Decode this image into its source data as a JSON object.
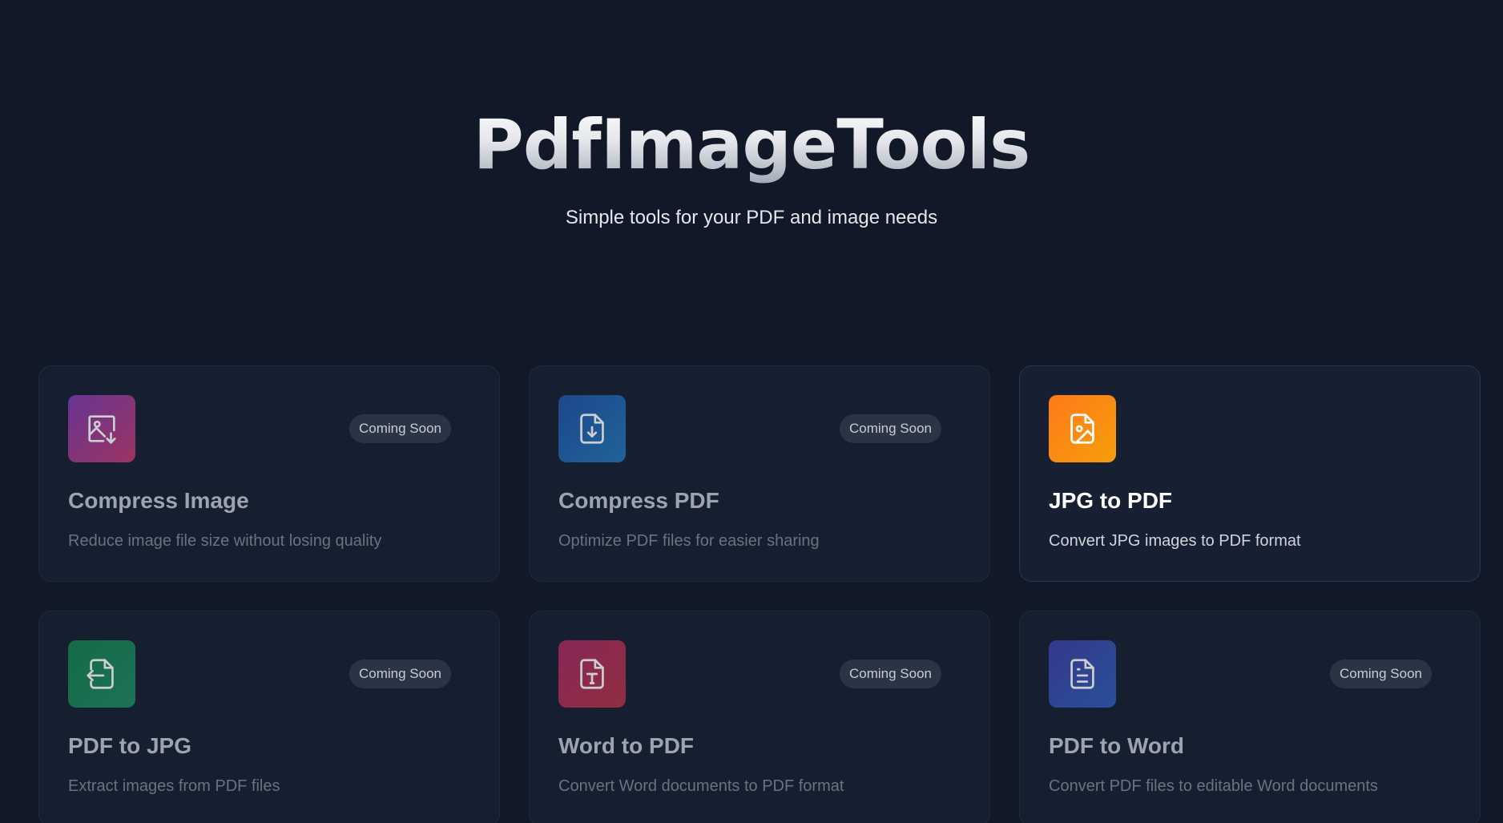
{
  "header": {
    "title": "PdfImageTools",
    "tagline": "Simple tools for your PDF and image needs"
  },
  "tools": [
    {
      "title": "Compress Image",
      "description": "Reduce image file size without losing quality",
      "badge": "Coming Soon",
      "icon": "image-download-icon",
      "gradient": [
        "#7e3bb0",
        "#c23a6e"
      ],
      "status": "coming-soon"
    },
    {
      "title": "Compress PDF",
      "description": "Optimize PDF files for easier sharing",
      "badge": "Coming Soon",
      "icon": "file-download-icon",
      "gradient": [
        "#2152a8",
        "#2277b5"
      ],
      "status": "coming-soon"
    },
    {
      "title": "JPG to PDF",
      "description": "Convert JPG images to PDF format",
      "badge": "",
      "icon": "file-image-icon",
      "gradient": [
        "#ff7a18",
        "#f59e0b"
      ],
      "status": "available"
    },
    {
      "title": "PDF to JPG",
      "description": "Extract images from PDF files",
      "badge": "Coming Soon",
      "icon": "file-export-icon",
      "gradient": [
        "#157f4c",
        "#1f8a64"
      ],
      "status": "coming-soon"
    },
    {
      "title": "Word to PDF",
      "description": "Convert Word documents to PDF format",
      "badge": "Coming Soon",
      "icon": "file-type-icon",
      "gradient": [
        "#a82b62",
        "#b33245"
      ],
      "status": "coming-soon"
    },
    {
      "title": "PDF to Word",
      "description": "Convert PDF files to editable Word documents",
      "badge": "Coming Soon",
      "icon": "file-text-icon",
      "gradient": [
        "#3f3fa6",
        "#2d5fb5"
      ],
      "status": "coming-soon"
    }
  ]
}
